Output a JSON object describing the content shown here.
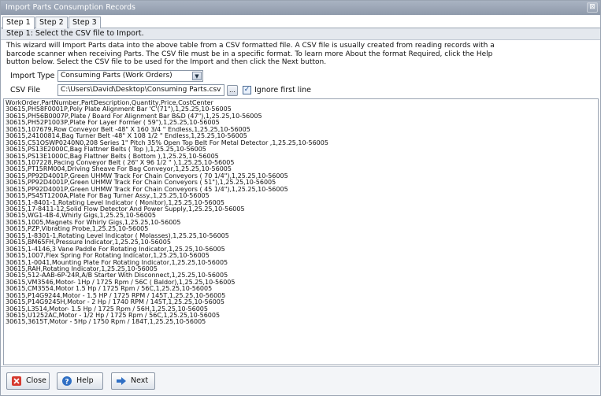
{
  "window": {
    "title": "Import Parts Consumption Records",
    "close_glyph": "⊠"
  },
  "tabs": [
    "Step 1",
    "Step 2",
    "Step 3"
  ],
  "step_title": "Step 1: Select the CSV file to Import.",
  "description": [
    "This wizard will Import Parts data into the above table from a CSV formatted file.   A CSV file is usually created from reading records with a",
    "barcode scanner when receiving Parts.  The CSV file must be in a specific format.  To learn more About the format Required, click the Help",
    "button below.  Select the CSV file to be used for the Import and then click the Next button."
  ],
  "import_type": {
    "label": "Import Type",
    "value": "Consuming Parts (Work Orders)"
  },
  "csv_file": {
    "label": "CSV File",
    "value": "C:\\Users\\David\\Desktop\\Consuming Parts.csv",
    "browse_glyph": "…"
  },
  "ignore_first_line": {
    "label": "Ignore first line",
    "checked": true
  },
  "csv_lines": [
    "WorkOrder,PartNumber,PartDescription,Quantity,Price,CostCenter",
    "30615,PH58F0001P,Poly Plate Alignment Bar 'C'(71\"),1,25.25,10-56005",
    "30615,PH56B0007P,Plate / Board For Alignment Bar B&D (47\"),1,25.25,10-56005",
    "30615,PH52P1003P,Plate For Layer Former ( 59\"),1,25.25,10-56005",
    "30615,107679,Row Conveyor Belt -48\" X 160 3/4 \" Endless,1,25.25,10-56005",
    "30615,24100814,Bag Turner Belt -48\" X 108 1/2 \" Endless,1,25.25,10-56005",
    "30615,C51OSWP0240N0,208 Series 1\" Pitch 35% Open Top Belt For Metal Detector ,1,25.25,10-56005",
    "30615,PS13E2000C,Bag Flattner Belts ( Top ),1,25.25,10-56005",
    "30615,PS13E1000C,Bag Flattner Belts ( Bottom ),1,25.25,10-56005",
    "30615,107228,Pacing Conveyor Belt ( 26\" X 96 1/2 \" ),1,25.25,10-56005",
    "30615,PT15RM004,Driving Sheave For Bag Conveyor,1,25.25,10-56005",
    "30615,PP92D4001P,Green UHMW Track For Chain Conveyors ( 70 1/4\"),1,25.25,10-56005",
    "30615,PP92D4001P,Green UHMW Track For Chain Conveyors ( 51\"),1,25.25,10-56005",
    "30615,PP92D4001P,Green UHMW Track For Chain Conveyors ( 45 1/4\"),1,25.25,10-56005",
    "30615,PS45T1200A,Plate For Bag Turner Assy.,1,25.25,10-56005",
    "30615,1-8401-1,Rotating Level Indicator ( Monitor),1,25.25,10-56005",
    "30615,17-8411-12,Solid Flow Detector And Power Supply,1,25.25,10-56005",
    "30615,WG1-4B-4,Whirly Gigs,1,25.25,10-56005",
    "30615,1005,Magnets For Whirly Gigs,1,25.25,10-56005",
    "30615,PZP,Vibrating Probe,1,25.25,10-56005",
    "30615,1-8301-1,Rotating Level Indicator ( Molasses),1,25.25,10-56005",
    "30615,BM65FH,Pressure Indicator,1,25.25,10-56005",
    "30615,1-4146,3 Vane Paddle For Rotating Indicator,1,25.25,10-56005",
    "30615,1007,Flex Spring For Rotating Indicator,1,25.25,10-56005",
    "30615,1-0041,Mounting Plate For Rotating Indicator,1,25.25,10-56005",
    "30615,RAH,Rotating Indicator,1,25.25,10-56005",
    "30615,512-AAB-6P-24R,A/B Starter With Disconnect,1,25.25,10-56005",
    "30615,VM3546,Motor- 1Hp / 1725 Rpm / 56C ( Baldor),1,25.25,10-56005",
    "30615,CM3554,Motor 1.5 Hp / 1725 Rpm / 56C,1,25.25,10-56005",
    "30615,P14G9244,Motor - 1.5 HP / 1725 RPM / 145T,1,25.25,10-56005",
    "30615,P14G9245H,Motor - 2 Hp / 1740 RPM / 145T,1,25.25,10-56005",
    "30615,L3514,Motor- 1.5 Hp / 1725 Rpm / 56H,1,25.25,10-56005",
    "30615,U1252AC,Motor - 1/2 Hp / 1725 Rpm / 56C,1,25.25,10-56005",
    "30615,3615T,Motor - 5Hp / 1750 Rpm / 184T,1,25.25,10-56005"
  ],
  "buttons": {
    "close": "Close",
    "help": "Help",
    "next": "Next"
  },
  "colors": {
    "titlebar": "#98a3b3",
    "close_icon": "#d63a2f",
    "help_icon": "#2f6fc4",
    "next_icon": "#2f6fc4"
  }
}
